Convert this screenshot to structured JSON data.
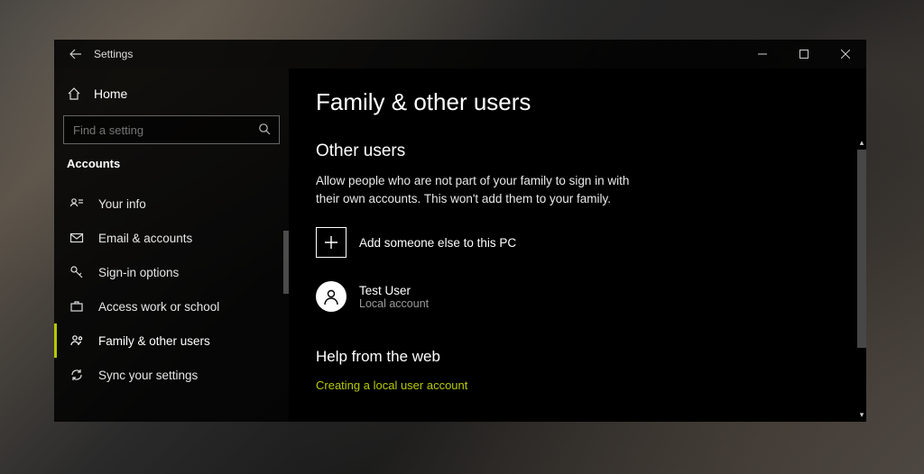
{
  "window": {
    "title": "Settings"
  },
  "sidebar": {
    "home": "Home",
    "search_placeholder": "Find a setting",
    "category": "Accounts",
    "items": [
      {
        "label": "Your info"
      },
      {
        "label": "Email & accounts"
      },
      {
        "label": "Sign-in options"
      },
      {
        "label": "Access work or school"
      },
      {
        "label": "Family & other users"
      },
      {
        "label": "Sync your settings"
      }
    ]
  },
  "main": {
    "title": "Family & other users",
    "section_title": "Other users",
    "section_desc": "Allow people who are not part of your family to sign in with their own accounts. This won't add them to your family.",
    "add_label": "Add someone else to this PC",
    "user": {
      "name": "Test User",
      "sub": "Local account"
    },
    "help_title": "Help from the web",
    "help_link": "Creating a local user account"
  }
}
